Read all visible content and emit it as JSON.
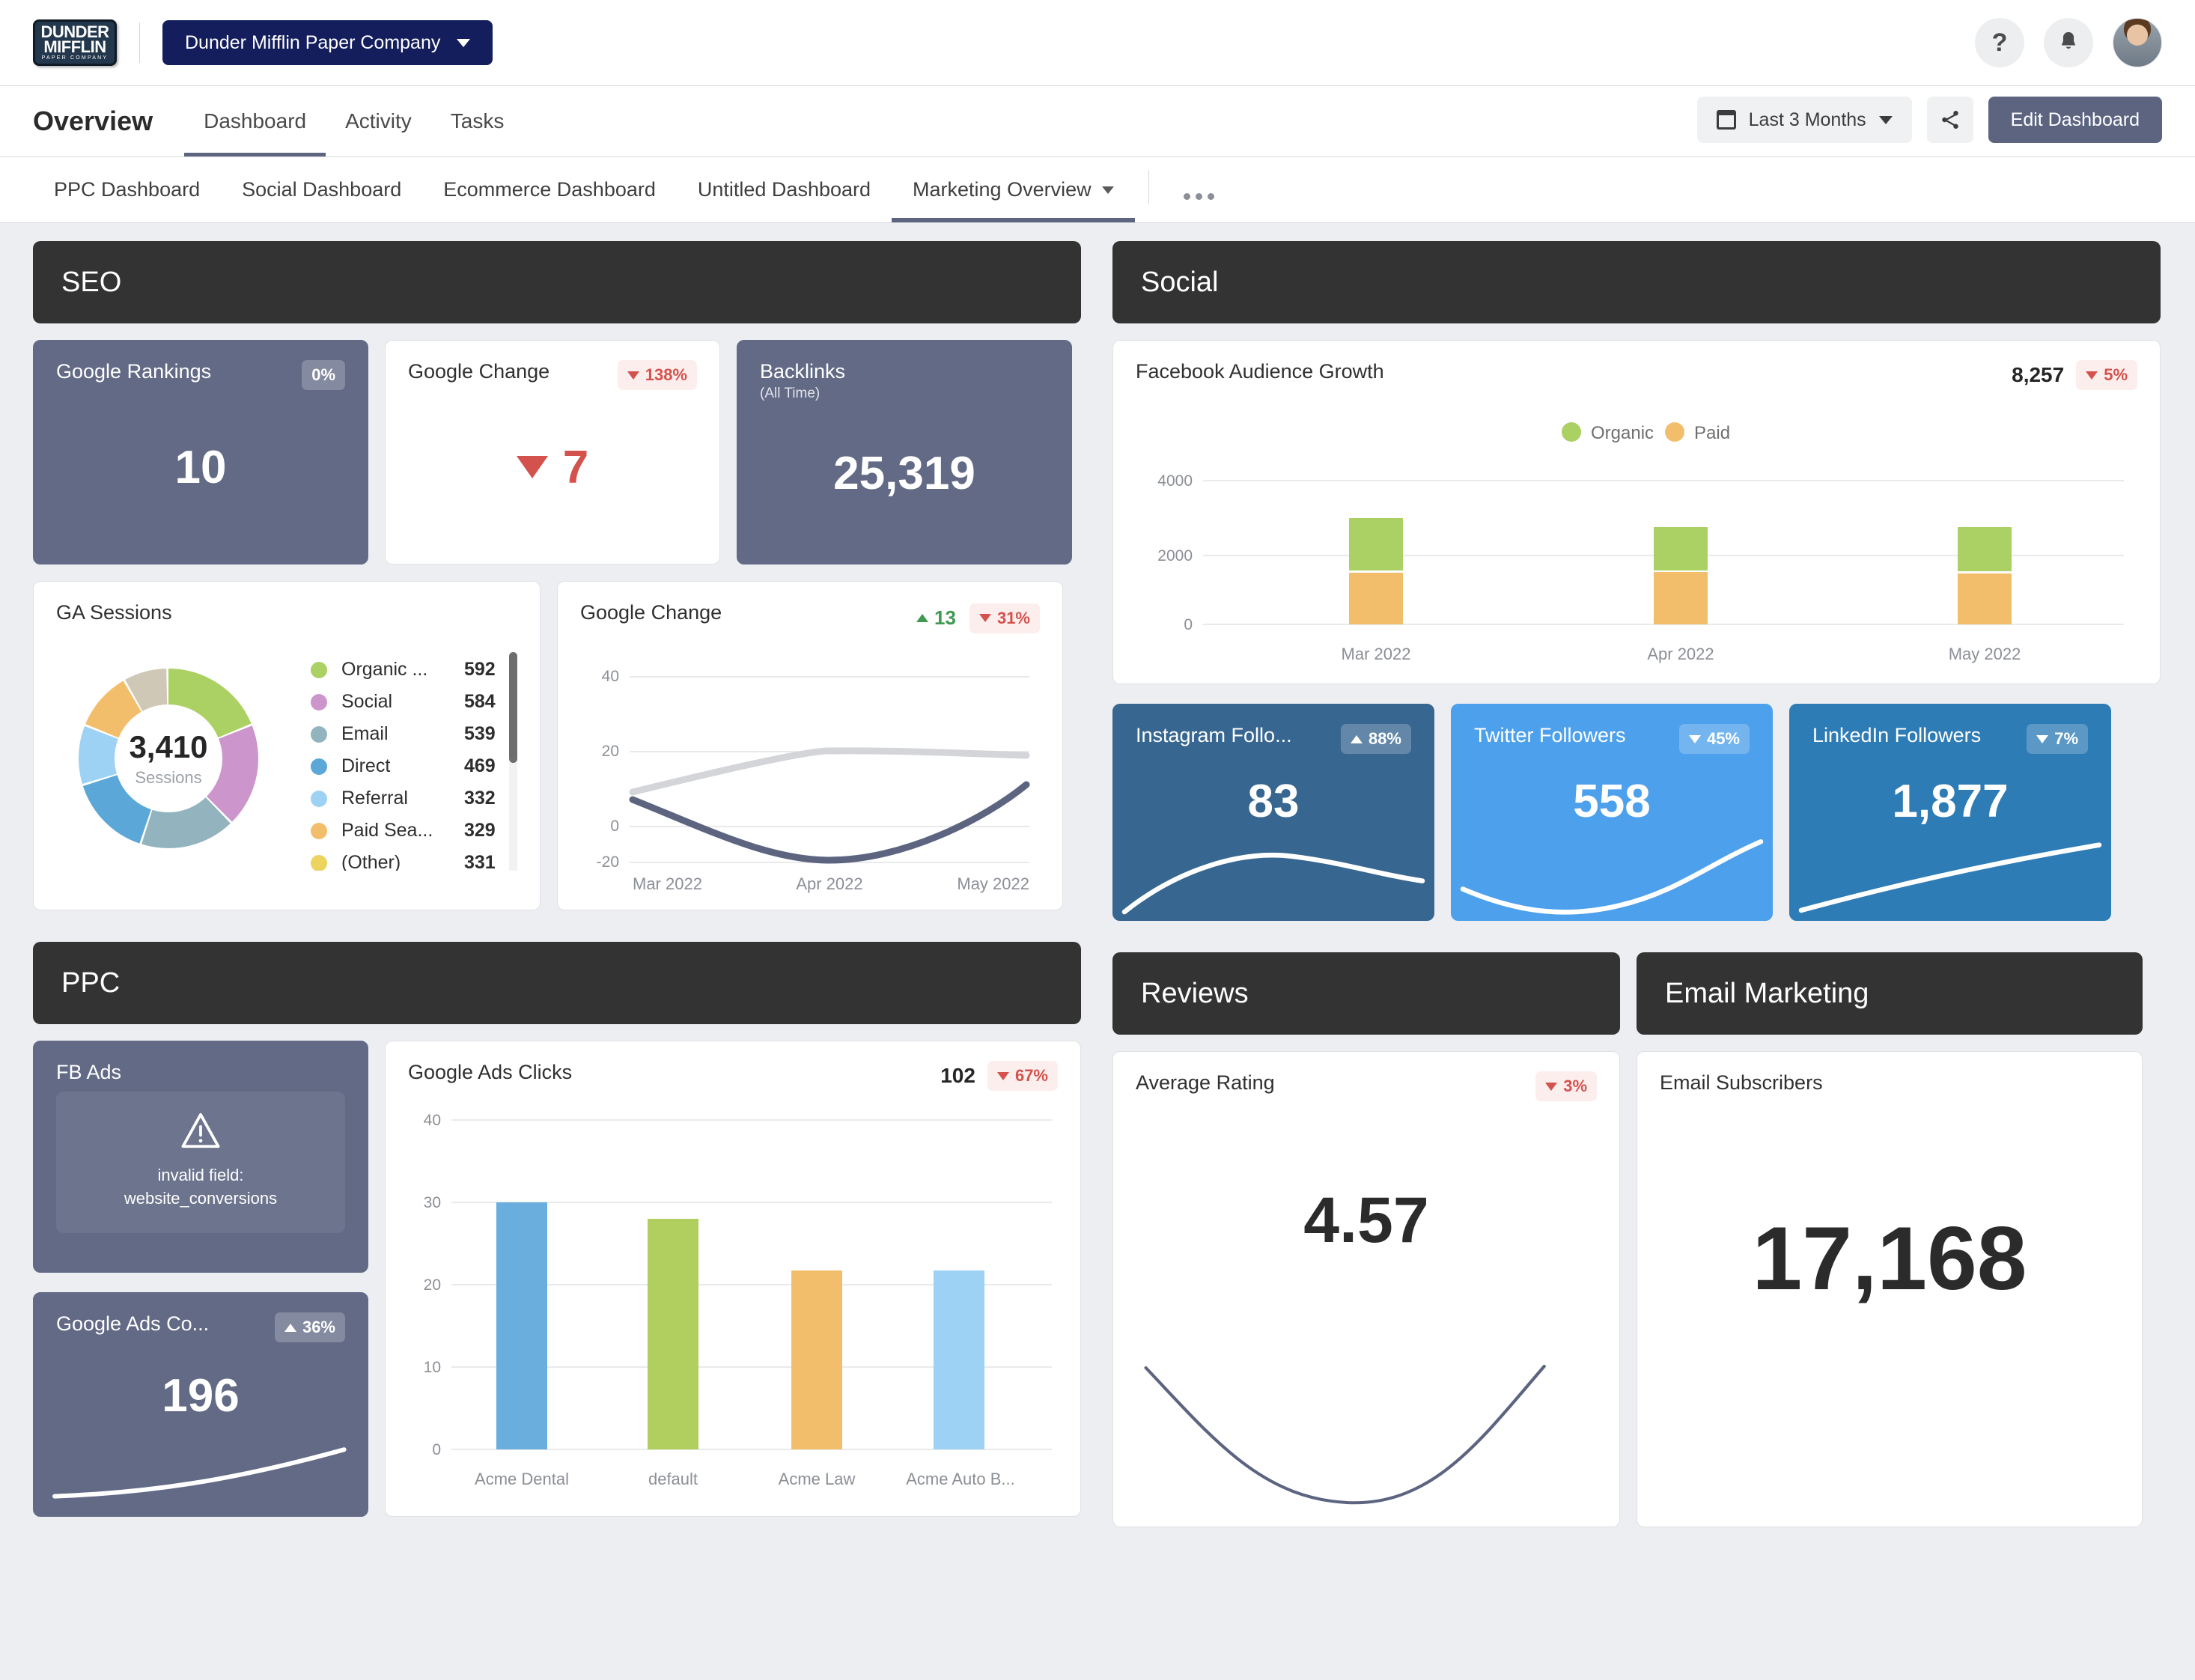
{
  "topbar": {
    "logo": {
      "line1": "DUNDER",
      "line2": "MIFFLIN",
      "line3": "PAPER COMPANY"
    },
    "company": "Dunder Mifflin Paper Company",
    "help_icon": "?",
    "icons": {
      "bell": "bell-icon",
      "avatar": "user-avatar"
    }
  },
  "header": {
    "title": "Overview",
    "tabs": [
      {
        "label": "Dashboard",
        "active": true
      },
      {
        "label": "Activity",
        "active": false
      },
      {
        "label": "Tasks",
        "active": false
      }
    ],
    "date_range": "Last 3 Months",
    "share_label": "share-icon",
    "edit_label": "Edit Dashboard"
  },
  "dashboard_tabs": [
    {
      "label": "PPC Dashboard",
      "active": false,
      "caret": false
    },
    {
      "label": "Social Dashboard",
      "active": false,
      "caret": false
    },
    {
      "label": "Ecommerce Dashboard",
      "active": false,
      "caret": false
    },
    {
      "label": "Untitled Dashboard",
      "active": false,
      "caret": false
    },
    {
      "label": "Marketing Overview",
      "active": true,
      "caret": true
    }
  ],
  "sections": {
    "seo": "SEO",
    "social": "Social",
    "ppc": "PPC",
    "reviews": "Reviews",
    "email": "Email Marketing"
  },
  "seo": {
    "google_rankings": {
      "title": "Google Rankings",
      "badge": "0%",
      "value": "10"
    },
    "google_change_kpi": {
      "title": "Google Change",
      "badge": "138%",
      "badge_dir": "down",
      "value": "7"
    },
    "backlinks": {
      "title": "Backlinks",
      "subtitle": "(All Time)",
      "value": "25,319"
    },
    "ga_sessions": {
      "title": "GA Sessions",
      "center_value": "3,410",
      "center_label": "Sessions"
    },
    "google_change_chart": {
      "title": "Google Change",
      "badge_value": "13",
      "badge_pct": "31%"
    }
  },
  "social": {
    "facebook": {
      "title": "Facebook Audience Growth",
      "total": "8,257",
      "badge": "5%"
    },
    "instagram": {
      "title": "Instagram Follo...",
      "badge": "88%",
      "badge_dir": "up",
      "value": "83"
    },
    "twitter": {
      "title": "Twitter Followers",
      "badge": "45%",
      "badge_dir": "down",
      "value": "558"
    },
    "linkedin": {
      "title": "LinkedIn Followers",
      "badge": "7%",
      "badge_dir": "down",
      "value": "1,877"
    }
  },
  "ppc": {
    "fb_ads": {
      "title": "FB Ads",
      "error_line1": "invalid field:",
      "error_line2": "website_conversions",
      "icon": "warning-triangle-icon"
    },
    "google_ads_conv": {
      "title": "Google Ads Co...",
      "badge": "36%",
      "badge_dir": "up",
      "value": "196"
    },
    "google_ads_clicks": {
      "title": "Google Ads Clicks",
      "total": "102",
      "badge": "67%"
    }
  },
  "reviews": {
    "average_rating": {
      "title": "Average Rating",
      "badge": "3%",
      "value": "4.57"
    }
  },
  "email": {
    "subscribers": {
      "title": "Email Subscribers",
      "value": "17,168"
    }
  },
  "colors": {
    "accent": "#5c6480",
    "section_header": "#333333",
    "kpi_dark": "#626a85",
    "red": "#d4524d",
    "green": "#3f9a50",
    "organic": "#abd063",
    "paid": "#f3be6b",
    "page_bg": "#eceef1"
  },
  "chart_data": [
    {
      "id": "ga_sessions_donut",
      "type": "pie",
      "title": "GA Sessions",
      "center_value": "3,410",
      "center_label": "Sessions",
      "legend_position": "right",
      "categories": [
        "Organic ...",
        "Social",
        "Email",
        "Direct",
        "Referral",
        "Paid Sea...",
        "(Other)"
      ],
      "values": [
        592,
        584,
        539,
        469,
        332,
        329,
        331
      ],
      "colors": [
        "#abd063",
        "#cc96cc",
        "#93b4bf",
        "#5aa7d8",
        "#9ed2f5",
        "#f3be6b",
        "#edd45e"
      ],
      "visible_legend_rows": 6
    },
    {
      "id": "google_change_line",
      "type": "line",
      "title": "Google Change",
      "x": [
        "Mar 2022",
        "Apr 2022",
        "May 2022"
      ],
      "series": [
        {
          "name": "current",
          "values": [
            7,
            -8,
            12
          ],
          "color": "#5c6480"
        },
        {
          "name": "previous",
          "values": [
            9,
            20,
            18
          ],
          "color": "#d4d5d9"
        }
      ],
      "ylim": [
        -20,
        40
      ],
      "yticks": [
        -20,
        0,
        20,
        40
      ],
      "xlabel": "",
      "ylabel": "",
      "grid": true
    },
    {
      "id": "facebook_audience_growth",
      "type": "bar",
      "stacked": true,
      "title": "Facebook Audience Growth",
      "categories": [
        "Mar 2022",
        "Apr 2022",
        "May 2022"
      ],
      "series": [
        {
          "name": "Paid",
          "values": [
            1350,
            1370,
            1320
          ],
          "color": "#f3be6b"
        },
        {
          "name": "Organic",
          "values": [
            1400,
            1180,
            1220
          ],
          "color": "#abd063"
        }
      ],
      "ylim": [
        0,
        4000
      ],
      "yticks": [
        0,
        2000,
        4000
      ],
      "legend_position": "top",
      "grid": true
    },
    {
      "id": "google_ads_clicks",
      "type": "bar",
      "title": "Google Ads Clicks",
      "categories": [
        "Acme Dental",
        "default",
        "Acme Law",
        "Acme Auto B..."
      ],
      "values": [
        30,
        28,
        21.7,
        21.7
      ],
      "colors": [
        "#6aaedd",
        "#b0cf5e",
        "#f3be6b",
        "#9ed2f5"
      ],
      "ylim": [
        0,
        40
      ],
      "yticks": [
        0,
        10,
        20,
        30,
        40
      ],
      "grid": true
    }
  ]
}
